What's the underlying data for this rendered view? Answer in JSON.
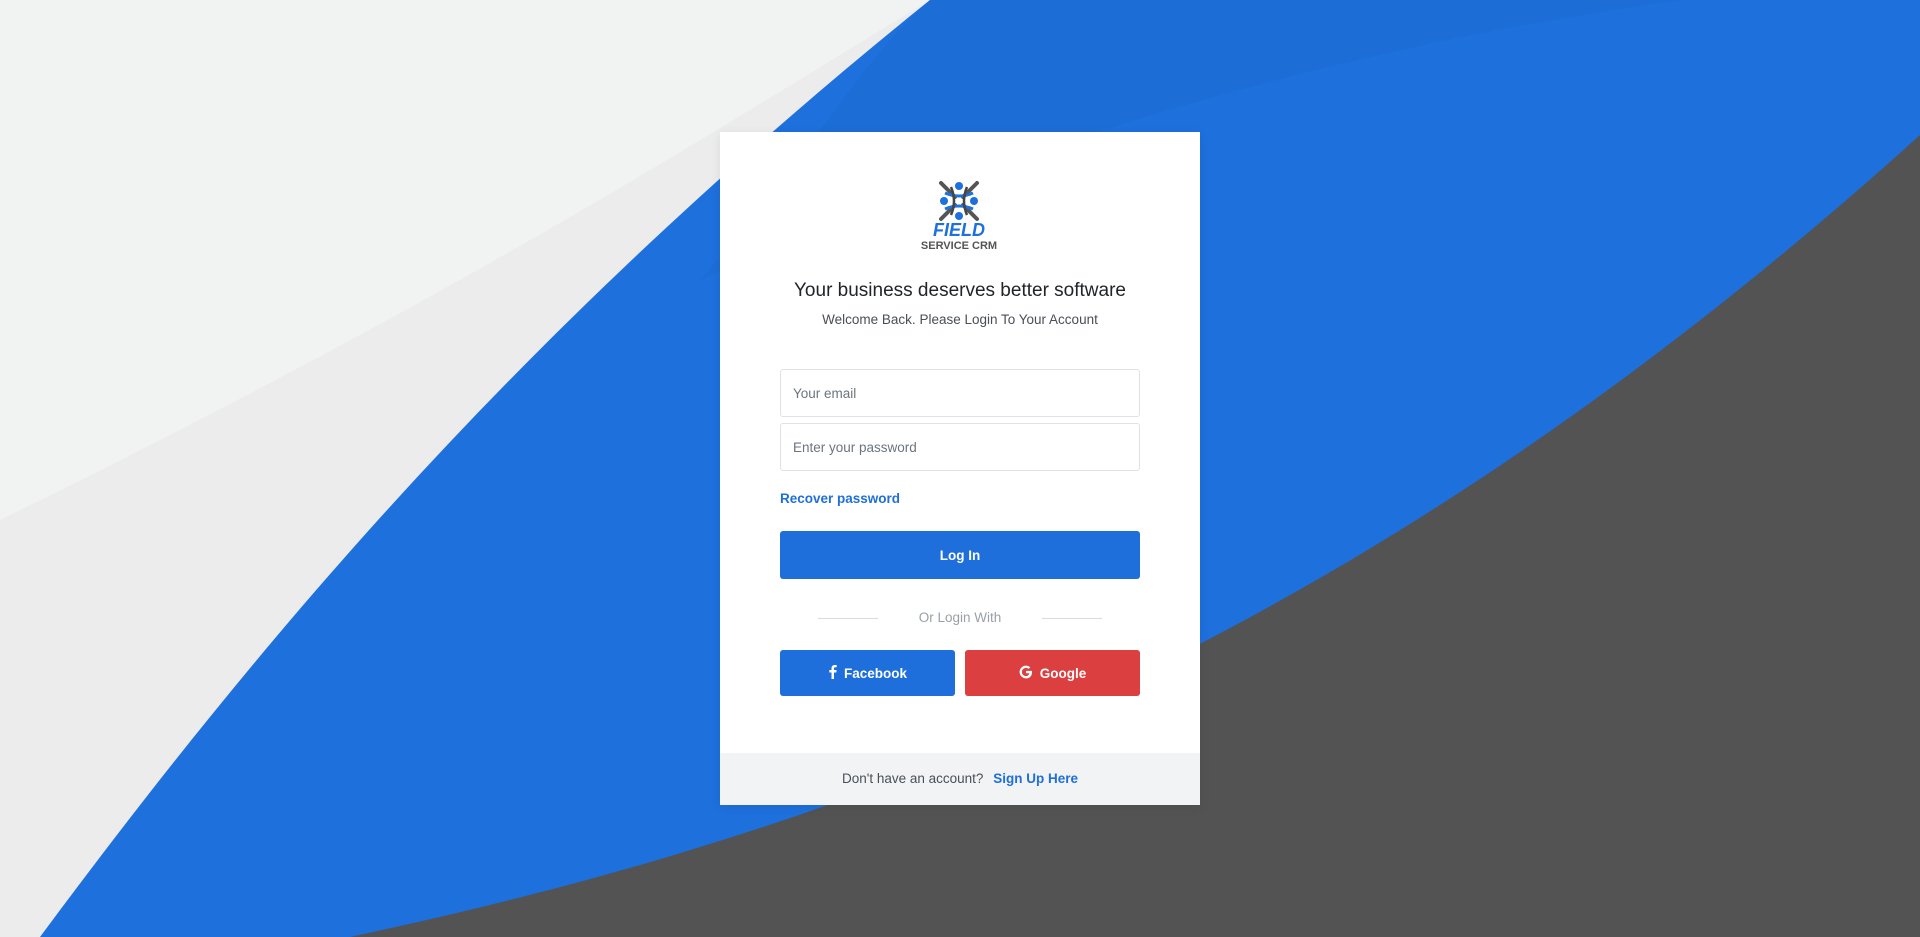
{
  "brand": {
    "logo_line1": "FIELD",
    "logo_line2": "SERVICE CRM",
    "logo_icon": "field-service-crm-logo",
    "accent_color": "#1e6fdb",
    "google_color": "#dc3f3f"
  },
  "login": {
    "title": "Your business deserves better software",
    "subtitle": "Welcome Back. Please Login To Your Account",
    "email_placeholder": "Your email",
    "password_placeholder": "Enter your password",
    "recover_label": "Recover password",
    "login_label": "Log In",
    "divider_text": "Or Login With",
    "facebook_label": "Facebook",
    "facebook_icon": "facebook-icon",
    "google_label": "Google",
    "google_icon": "google-icon"
  },
  "footer": {
    "prompt": "Don't have an account?",
    "signup_label": "Sign Up Here"
  }
}
